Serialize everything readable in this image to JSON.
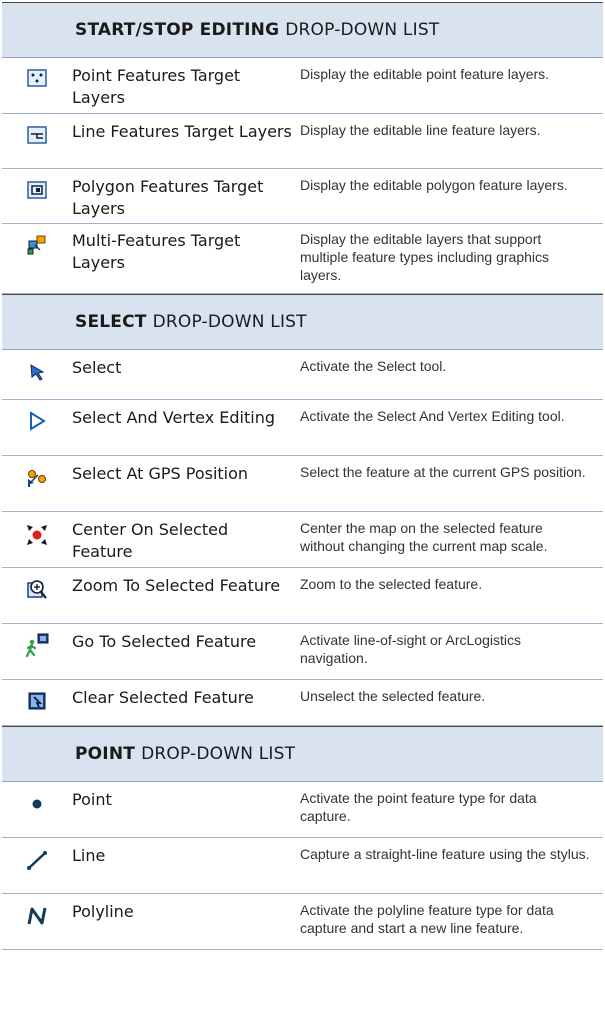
{
  "sections": [
    {
      "title_bold": "START/STOP EDITING",
      "title_rest": "DROP-DOWN LIST",
      "items": [
        {
          "name": "Point Features Target Layers",
          "desc": "Display the editable point feature layers.",
          "icon": "point-features-icon"
        },
        {
          "name": "Line Features Target Layers",
          "desc": "Display the editable line feature layers.",
          "icon": "line-features-icon"
        },
        {
          "name": "Polygon Features Target Layers",
          "desc": "Display the editable polygon feature layers.",
          "icon": "polygon-features-icon"
        },
        {
          "name": "Multi-Features Target Layers",
          "desc": "Display the editable layers that support multiple feature types including graphics layers.",
          "icon": "multi-features-icon"
        }
      ]
    },
    {
      "title_bold": "SELECT",
      "title_rest": "DROP-DOWN LIST",
      "items": [
        {
          "name": "Select",
          "desc": "Activate the Select tool.",
          "icon": "select-arrow-icon"
        },
        {
          "name": "Select And Vertex Editing",
          "desc": "Activate the Select And Vertex Editing tool.",
          "icon": "vertex-edit-icon"
        },
        {
          "name": "Select At GPS Position",
          "desc": "Select the feature at the current GPS position.",
          "icon": "gps-select-icon"
        },
        {
          "name": "Center On Selected Feature",
          "desc": "Center the map on the selected feature without changing the current map scale.",
          "icon": "center-feature-icon"
        },
        {
          "name": "Zoom To Selected Feature",
          "desc": "Zoom to the selected feature.",
          "icon": "zoom-feature-icon"
        },
        {
          "name": "Go To Selected Feature",
          "desc": "Activate line-of-sight or ArcLogistics navigation.",
          "icon": "goto-feature-icon"
        },
        {
          "name": "Clear Selected Feature",
          "desc": "Unselect the selected feature.",
          "icon": "clear-selection-icon"
        }
      ]
    },
    {
      "title_bold": "POINT",
      "title_rest": "DROP-DOWN LIST",
      "items": [
        {
          "name": "Point",
          "desc": "Activate the point feature type for data capture.",
          "icon": "point-dot-icon"
        },
        {
          "name": "Line",
          "desc": "Capture a straight-line feature using the stylus.",
          "icon": "line-stroke-icon"
        },
        {
          "name": "Polyline",
          "desc": "Activate the polyline feature type for data capture and start a new line feature.",
          "icon": "polyline-icon"
        }
      ]
    }
  ]
}
